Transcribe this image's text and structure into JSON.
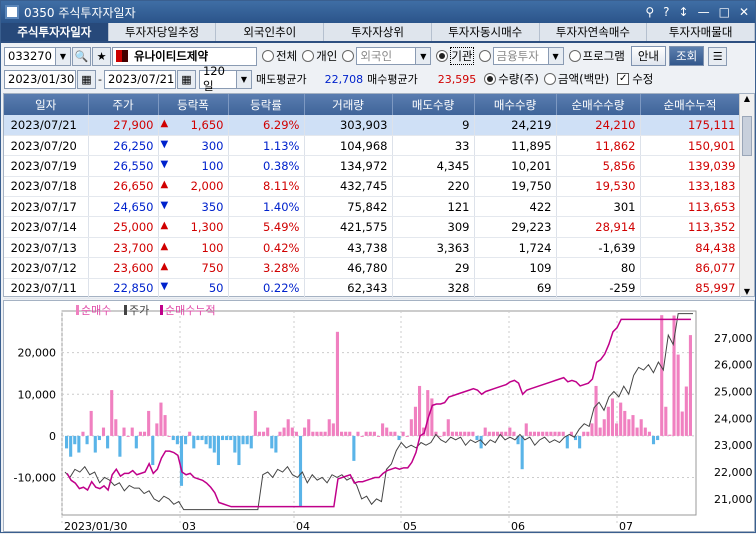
{
  "window": {
    "title": "0350 주식투자자일자",
    "buttons": [
      "⚲",
      "?",
      "↕",
      "—",
      "□",
      "✕"
    ]
  },
  "tabs": [
    "주식투자자일자",
    "투자자당일추정",
    "외국인추이",
    "투자자상위",
    "투자자동시매수",
    "투자자연속매수",
    "투자자매물대"
  ],
  "query": {
    "code": "033270",
    "name": "유나이티드제약",
    "radios_investor": [
      "전체",
      "개인",
      "외국인",
      "기관",
      "금융투자",
      "프로그램"
    ],
    "selected_investor": "기관",
    "btn_info": "안내",
    "btn_search": "조회"
  },
  "filter": {
    "start": "2023/01/30",
    "end": "2023/07/21",
    "period": "120일",
    "sell_avg_label": "매도평균가",
    "sell_avg": "22,708",
    "buy_avg_label": "매수평균가",
    "buy_avg": "23,595",
    "unit_qty": "수량(주)",
    "unit_amt": "금액(백만)",
    "edit_label": "수정"
  },
  "table": {
    "headers": [
      "일자",
      "주가",
      "등락폭",
      "등락률",
      "거래량",
      "매도수량",
      "매수수량",
      "순매수수량",
      "순매수누적"
    ],
    "rows": [
      [
        "2023/07/21",
        "27,900",
        "▲",
        "1,650",
        "6.29%",
        "303,903",
        "9",
        "24,219",
        "24,210",
        "175,111"
      ],
      [
        "2023/07/20",
        "26,250",
        "▼",
        "300",
        "1.13%",
        "104,968",
        "33",
        "11,895",
        "11,862",
        "150,901"
      ],
      [
        "2023/07/19",
        "26,550",
        "▼",
        "100",
        "0.38%",
        "134,972",
        "4,345",
        "10,201",
        "5,856",
        "139,039"
      ],
      [
        "2023/07/18",
        "26,650",
        "▲",
        "2,000",
        "8.11%",
        "432,745",
        "220",
        "19,750",
        "19,530",
        "133,183"
      ],
      [
        "2023/07/17",
        "24,650",
        "▼",
        "350",
        "1.40%",
        "75,842",
        "121",
        "422",
        "301",
        "113,653"
      ],
      [
        "2023/07/14",
        "25,000",
        "▲",
        "1,300",
        "5.49%",
        "421,575",
        "309",
        "29,223",
        "28,914",
        "113,352"
      ],
      [
        "2023/07/13",
        "23,700",
        "▲",
        "100",
        "0.42%",
        "43,738",
        "3,363",
        "1,724",
        "-1,639",
        "84,438"
      ],
      [
        "2023/07/12",
        "23,600",
        "▲",
        "750",
        "3.28%",
        "46,780",
        "29",
        "109",
        "80",
        "86,077"
      ],
      [
        "2023/07/11",
        "22,850",
        "▼",
        "50",
        "0.22%",
        "62,343",
        "328",
        "69",
        "-259",
        "85,997"
      ]
    ]
  },
  "chart_data": {
    "type": "bar",
    "legend": [
      "순매수",
      "주가",
      "순매수누적"
    ],
    "left_axis": {
      "ticks": [
        "20,000",
        "10,000",
        "0",
        "-10,000"
      ],
      "ylim": [
        -19000,
        30000
      ]
    },
    "right_axis": {
      "ticks": [
        "27,000",
        "26,000",
        "25,000",
        "24,000",
        "23,000",
        "22,000",
        "21,000"
      ],
      "ylim": [
        20400,
        28000
      ]
    },
    "x_labels": [
      "2023/01/30",
      "03",
      "04",
      "05",
      "06",
      "07"
    ],
    "net_buy": [
      -3000,
      -5000,
      -2000,
      -4000,
      1000,
      -2000,
      6000,
      -4000,
      -1000,
      2000,
      -3000,
      11000,
      4000,
      -5000,
      2000,
      0,
      2000,
      -3000,
      1000,
      1000,
      6000,
      -7000,
      3000,
      8000,
      5000,
      0,
      -1000,
      -2000,
      -12000,
      -2000,
      1000,
      -3000,
      -1000,
      -1000,
      -2000,
      -3000,
      -4000,
      -7000,
      -1000,
      -1000,
      -1000,
      -4000,
      -7000,
      -2000,
      -2000,
      -3000,
      6000,
      1000,
      1000,
      2000,
      -3000,
      -4000,
      1000,
      2000,
      4000,
      2000,
      1000,
      -17000,
      2000,
      4000,
      1000,
      1000,
      1000,
      1000,
      4000,
      3000,
      25000,
      1000,
      1000,
      1000,
      -6000,
      1000,
      0,
      1000,
      1000,
      1000,
      0,
      3000,
      2000,
      1000,
      1000,
      -1000,
      1000,
      0,
      4000,
      7000,
      12000,
      2000,
      11000,
      9000,
      1000,
      0,
      1000,
      4000,
      1000,
      1000,
      1000,
      1000,
      1000,
      1000,
      -1000,
      -3000,
      2000,
      1000,
      1000,
      1000,
      1000,
      1000,
      2000,
      1000,
      -2000,
      -8000,
      3000,
      1000,
      1000,
      1000,
      1000,
      1000,
      1000,
      1000,
      1000,
      1000,
      -3000,
      1000,
      -1000,
      -3000,
      1000,
      1000,
      3000,
      12000,
      2000,
      4000,
      7000,
      9000,
      3000,
      8000,
      6000,
      4000,
      5000,
      2000,
      4000,
      2000,
      1000,
      -2000,
      -1000,
      29000,
      7000,
      301,
      28914,
      19530,
      5856,
      11862,
      24210
    ]
  }
}
